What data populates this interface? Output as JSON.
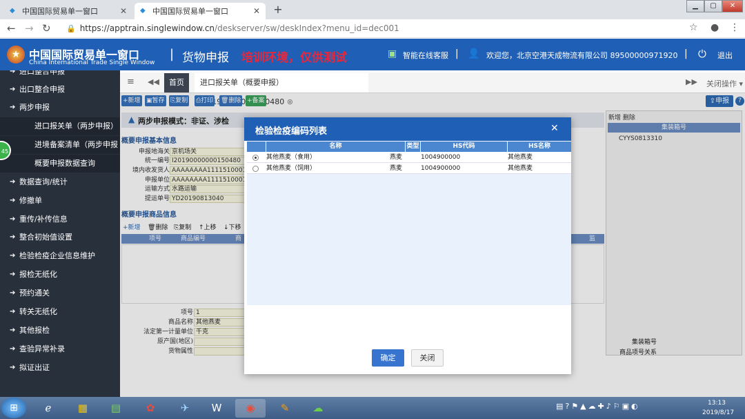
{
  "browser": {
    "tabs": [
      {
        "title": "中国国际贸易单一窗口"
      },
      {
        "title": "中国国际贸易单一窗口"
      }
    ],
    "url_host": "https://apptrain.singlewindow.cn",
    "url_path": "/deskserver/sw/deskIndex?menu_id=dec001"
  },
  "header": {
    "brand_cn": "中国国际贸易单一窗口",
    "brand_en": "China International Trade Single Window",
    "title": "货物申报",
    "env": "培训环境，仅供测试",
    "support": "智能在线客服",
    "welcome": "欢迎您，北京空港天成物流有限公司 89500000971920",
    "logout": "退出"
  },
  "sidebar": {
    "items": [
      {
        "label": "进口整合申报"
      },
      {
        "label": "出口整合申报"
      },
      {
        "label": "两步申报"
      },
      {
        "label": "进口报关单（两步申报）"
      },
      {
        "label": "进境备案清单（两步申报"
      },
      {
        "label": "概要申报数据查询"
      },
      {
        "label": "数据查询/统计"
      },
      {
        "label": "修撤单"
      },
      {
        "label": "重传/补传信息"
      },
      {
        "label": "整合初始值设置"
      },
      {
        "label": "检验检疫企业信息维护"
      },
      {
        "label": "报检无纸化"
      },
      {
        "label": "预约通关"
      },
      {
        "label": "转关无纸化"
      },
      {
        "label": "其他报检"
      },
      {
        "label": "查验异常补录"
      },
      {
        "label": "拟证出证"
      }
    ],
    "badge": "45"
  },
  "tabs": {
    "home": "首页",
    "doc": "进口报关单（概要申报）I20190000000150480",
    "close_ops": "关闭操作"
  },
  "toolbar": {
    "buttons": [
      "新增",
      "暂存",
      "复制",
      "打印",
      "删除",
      "备案"
    ],
    "declare": "申报",
    "help": "?"
  },
  "form": {
    "mode": "两步申报模式：非证、涉检",
    "section1": "概要申报基本信息",
    "fields": [
      {
        "label": "申报地海关",
        "value": "京机场关"
      },
      {
        "label": "统一编号",
        "value": "I20190000000150480"
      },
      {
        "label": "境内收发货人",
        "value": "AAAAAAAA1111510001"
      },
      {
        "label": "申报单位",
        "value": "AAAAAAAA1111510001"
      },
      {
        "label": "运输方式",
        "value": "水路运输"
      },
      {
        "label": "提运单号",
        "value": "YD20190813040"
      }
    ],
    "section2": "概要申报商品信息",
    "goods_tools": [
      "新增",
      "删除",
      "复制",
      "上移",
      "下移"
    ],
    "goods_cols": [
      "项号",
      "商品编号",
      "商",
      "监"
    ],
    "detail_fields": [
      {
        "label": "项号",
        "value": "1"
      },
      {
        "label": "商品名称",
        "value": "其他燕麦"
      },
      {
        "label": "法定第一计量单位",
        "value": "千克"
      },
      {
        "label": "原产国(地区)",
        "value": ""
      },
      {
        "label": "货物属性",
        "value": ""
      }
    ]
  },
  "right_panel": {
    "tools": "新增  删除",
    "col": "集装箱号",
    "row": "CYYS0813310",
    "bottom_label1": "集装箱号",
    "bottom_label2": "商品项号关系"
  },
  "modal": {
    "title": "检验检疫编码列表",
    "close": "✕",
    "columns": [
      "名称",
      "类型",
      "HS代码",
      "HS名称"
    ],
    "rows": [
      {
        "name": "其他燕麦（食用）",
        "type": "燕麦",
        "hs_code": "1004900000",
        "hs_name": "其他燕麦",
        "selected": true
      },
      {
        "name": "其他燕麦（饲用）",
        "type": "燕麦",
        "hs_code": "1004900000",
        "hs_name": "其他燕麦",
        "selected": false
      }
    ],
    "ok": "确定",
    "cancel": "关闭"
  },
  "taskbar": {
    "time": "13:13",
    "date": "2019/8/17"
  }
}
